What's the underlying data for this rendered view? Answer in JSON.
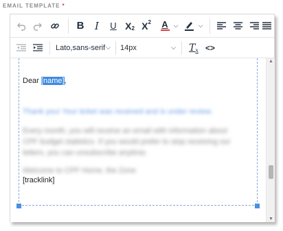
{
  "field": {
    "label": "EMAIL TEMPLATE",
    "required_marker": "*"
  },
  "toolbar_row1": {
    "undo_icon": "undo-icon",
    "redo_icon": "redo-icon",
    "link_icon": "link-icon",
    "bold_label": "B",
    "italic_label": "I",
    "underline_label": "U",
    "subscript_label": "X",
    "subscript_sub": "2",
    "superscript_label": "X",
    "superscript_sup": "2",
    "text_color_label": "A",
    "text_color": "#e53935",
    "highlight_icon": "highlight-icon",
    "highlight_color": "#222f3e",
    "align_icons": [
      "align-left-icon",
      "align-center-icon",
      "align-right-icon",
      "align-justify-icon"
    ]
  },
  "toolbar_row2": {
    "outdent_icon": "outdent-icon",
    "indent_icon": "indent-icon",
    "font_family": "Lato,sans-serif",
    "font_size": "14px",
    "clear_format_label": "T",
    "clear_format_sub": "x",
    "source_code_label": "<>"
  },
  "content": {
    "greeting_prefix": "Dear ",
    "greeting_token": "[name]",
    "greeting_suffix": ",",
    "blurred_link_text": "Thank you! Your ticket was received and is under review.",
    "blurred_paragraph_lines": [
      "Every month, you will receive an email with information about",
      "CPF budget statistics. If you would prefer to stop receiving our",
      "letters, you can unsubscribe anytime."
    ],
    "blurred_closing": "Welcome to CPF Home, the Zone",
    "tracklink": "[tracklink]"
  },
  "colors": {
    "selection": "#3f8ae0",
    "frame_border": "#7fa5d8",
    "handle": "#4a90e2",
    "required": "#e0343a"
  }
}
